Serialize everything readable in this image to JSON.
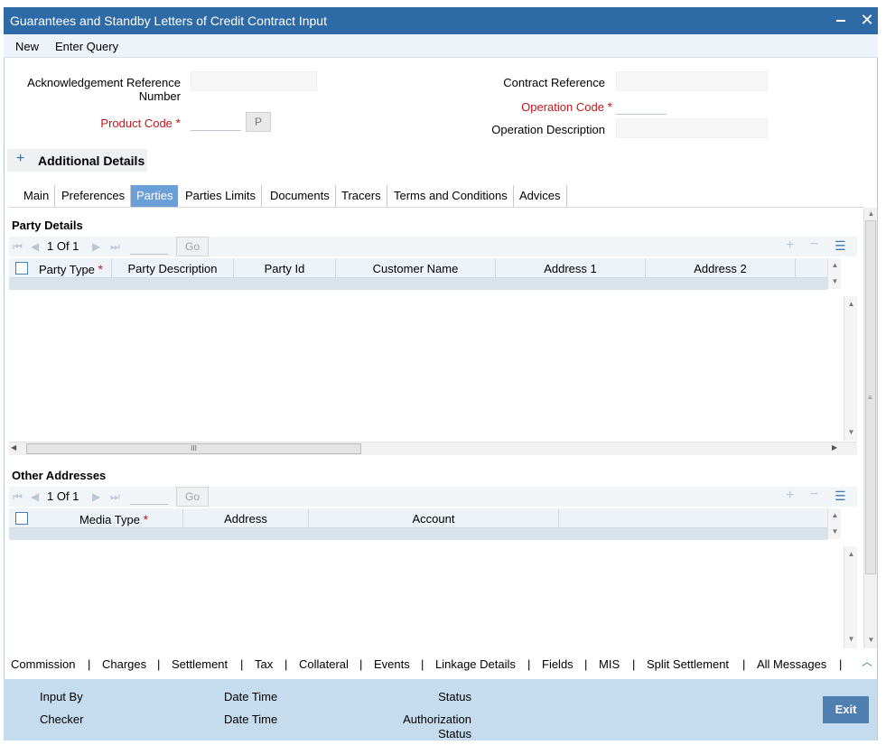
{
  "window": {
    "title": "Guarantees and Standby Letters of Credit Contract Input"
  },
  "menu": {
    "new": "New",
    "enter_query": "Enter Query"
  },
  "header": {
    "ack_ref_label_line1": "Acknowledgement Reference",
    "ack_ref_label_line2": "Number",
    "product_code_label": "Product Code",
    "required_mark": "*",
    "p_button": "P",
    "contract_ref_label": "Contract Reference",
    "operation_code_label": "Operation Code",
    "operation_desc_label": "Operation Description"
  },
  "additional_details": {
    "icon": "+",
    "label": "Additional Details"
  },
  "tabs": [
    {
      "label": "Main"
    },
    {
      "label": "Preferences"
    },
    {
      "label": "Parties"
    },
    {
      "label": "Parties Limits"
    },
    {
      "label": "Documents"
    },
    {
      "label": "Tracers"
    },
    {
      "label": "Terms and Conditions"
    },
    {
      "label": "Advices"
    }
  ],
  "party_details": {
    "title": "Party Details",
    "page_info": "1 Of 1",
    "go": "Go",
    "columns": {
      "party_type": "Party Type",
      "party_description": "Party Description",
      "party_id": "Party Id",
      "customer_name": "Customer Name",
      "address1": "Address 1",
      "address2": "Address 2"
    },
    "hscroll_thumb": "III"
  },
  "other_addresses": {
    "title": "Other Addresses",
    "page_info": "1 Of 1",
    "go": "Go",
    "columns": {
      "media_type": "Media Type",
      "address": "Address",
      "account": "Account"
    }
  },
  "bottom_links": {
    "commission": "Commission",
    "charges": "Charges",
    "settlement": "Settlement",
    "tax": "Tax",
    "collateral": "Collateral",
    "events": "Events",
    "linkage": "Linkage Details",
    "fields": "Fields",
    "mis": "MIS",
    "split": "Split Settlement",
    "all_messages": "All Messages",
    "separator": "|"
  },
  "footer": {
    "input_by": "Input By",
    "checker": "Checker",
    "date_time": "Date Time",
    "status": "Status",
    "auth_status_line1": "Authorization",
    "auth_status_line2": "Status",
    "exit": "Exit"
  }
}
